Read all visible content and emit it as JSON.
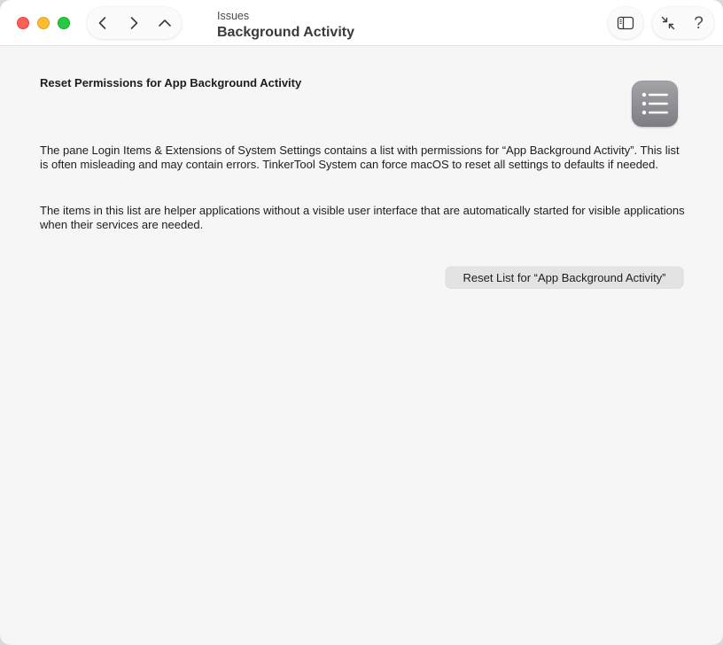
{
  "window": {
    "breadcrumb": "Issues",
    "title": "Background Activity"
  },
  "toolbar": {
    "back_icon": "chevron-left-icon",
    "forward_icon": "chevron-right-icon",
    "up_icon": "chevron-up-icon",
    "sidebar_icon": "sidebar-icon",
    "collapse_icon": "collapse-arrows-icon",
    "help_label": "?"
  },
  "main": {
    "heading": "Reset Permissions for App Background Activity",
    "icon": "list-icon",
    "paragraph1": "The pane Login Items & Extensions of System Settings contains a list with permissions for “App Background Activity”. This list is often misleading and may contain errors. TinkerTool System can force macOS to reset all settings to defaults if needed.",
    "paragraph2": "The items in this list are helper applications without a visible user interface that are automatically started for visible applications when their services are needed.",
    "reset_button_label": "Reset List for “App Background Activity”"
  },
  "colors": {
    "close": "#fe5f57",
    "minimize": "#febc2e",
    "zoom": "#28c840",
    "background": "#f6f6f6",
    "titlebar": "#ffffff"
  }
}
